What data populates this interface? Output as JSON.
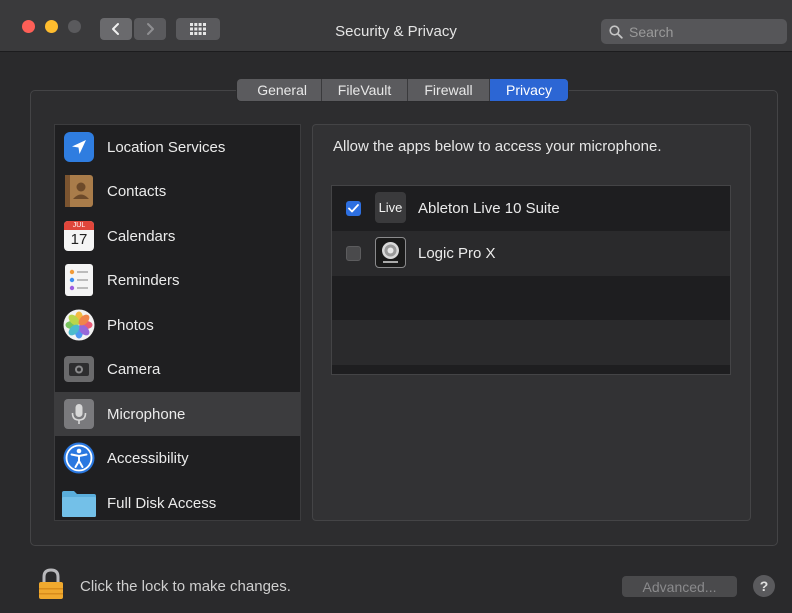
{
  "window": {
    "title": "Security & Privacy",
    "search_placeholder": "Search"
  },
  "tabs": [
    {
      "label": "General",
      "selected": false
    },
    {
      "label": "FileVault",
      "selected": false
    },
    {
      "label": "Firewall",
      "selected": false
    },
    {
      "label": "Privacy",
      "selected": true
    }
  ],
  "sidebar": {
    "items": [
      {
        "label": "Location Services",
        "icon": "location-arrow-icon"
      },
      {
        "label": "Contacts",
        "icon": "contacts-book-icon"
      },
      {
        "label": "Calendars",
        "icon": "calendar-icon",
        "icon_month": "JUL",
        "icon_day": "17"
      },
      {
        "label": "Reminders",
        "icon": "reminders-list-icon"
      },
      {
        "label": "Photos",
        "icon": "photos-flower-icon"
      },
      {
        "label": "Camera",
        "icon": "camera-icon"
      },
      {
        "label": "Microphone",
        "icon": "microphone-icon",
        "selected": true
      },
      {
        "label": "Accessibility",
        "icon": "accessibility-icon"
      },
      {
        "label": "Full Disk Access",
        "icon": "folder-icon"
      }
    ]
  },
  "privacy": {
    "description": "Allow the apps below to access your microphone.",
    "apps": [
      {
        "name": "Ableton Live 10 Suite",
        "checked": true,
        "icon": "ableton-live-icon",
        "icon_text": "Live"
      },
      {
        "name": "Logic Pro X",
        "checked": false,
        "icon": "logic-pro-icon"
      }
    ]
  },
  "footer": {
    "lock_text": "Click the lock to make changes.",
    "advanced_label": "Advanced...",
    "help_label": "?"
  },
  "colors": {
    "accent": "#2c66d4",
    "window_bg": "#2a2a2c",
    "close": "#fe5f57",
    "minimize": "#febc2e",
    "zoom": "#5a5a5d"
  }
}
